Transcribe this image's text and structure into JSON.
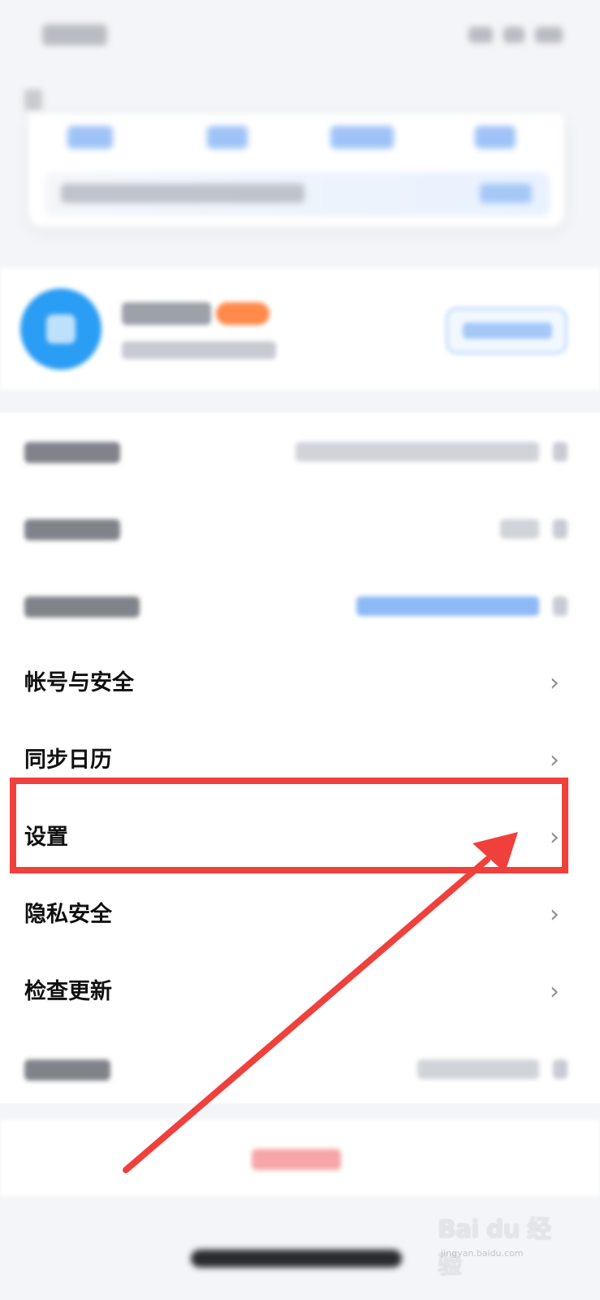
{
  "menu": {
    "items": [
      {
        "label": "帐号与安全"
      },
      {
        "label": "同步日历"
      },
      {
        "label": "设置"
      },
      {
        "label": "隐私安全"
      },
      {
        "label": "检查更新"
      }
    ],
    "chevron": "›"
  },
  "annotation": {
    "box_color": "#f0403c",
    "arrow_color": "#f0403c"
  },
  "watermark": {
    "brand": "Bai du 经验",
    "domain": "jingyan.baidu.com"
  },
  "colors": {
    "accent": "#2a9df4",
    "page_bg": "#f4f5f8"
  }
}
